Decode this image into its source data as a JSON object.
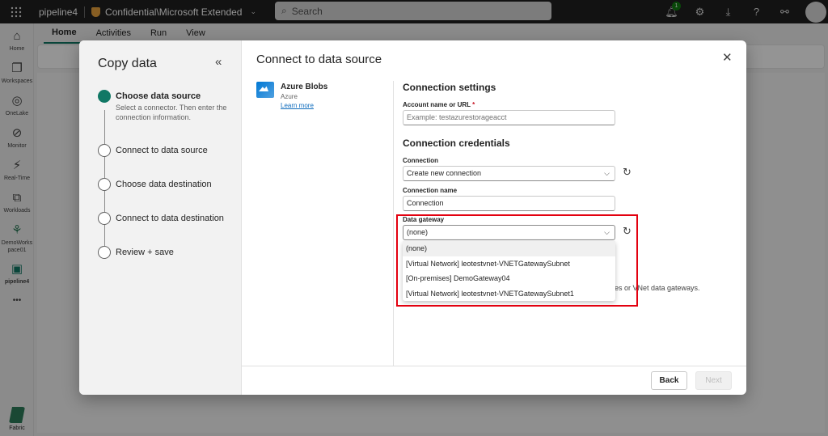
{
  "topbar": {
    "app_title": "pipeline4",
    "sensitivity_label": "Confidential\\Microsoft Extended",
    "search_placeholder": "Search",
    "notification_count": "1"
  },
  "rail": {
    "items": [
      {
        "label": "Home",
        "icon": "home-icon"
      },
      {
        "label": "Workspaces",
        "icon": "workspaces-icon"
      },
      {
        "label": "OneLake",
        "icon": "onelake-icon"
      },
      {
        "label": "Monitor",
        "icon": "monitor-icon"
      },
      {
        "label": "Real-Time",
        "icon": "realtime-icon"
      },
      {
        "label": "Workloads",
        "icon": "workloads-icon"
      },
      {
        "label": "DemoWorkspace01",
        "icon": "workspace-icon"
      },
      {
        "label": "pipeline4",
        "icon": "pipeline-icon"
      }
    ],
    "more": "•••",
    "footer_label": "Fabric"
  },
  "ribbon": {
    "tabs": [
      "Home",
      "Activities",
      "Run",
      "View"
    ]
  },
  "dialog": {
    "panel_title": "Copy data",
    "collapse_glyph": "«",
    "close_glyph": "✕",
    "main_title": "Connect to data source",
    "steps": [
      {
        "label": "Choose data source",
        "desc": "Select a connector. Then enter the connection information.",
        "active": true
      },
      {
        "label": "Connect to data source",
        "active": false
      },
      {
        "label": "Choose data destination",
        "active": false
      },
      {
        "label": "Connect to data destination",
        "active": false
      },
      {
        "label": "Review + save",
        "active": false
      }
    ],
    "connector": {
      "name": "Azure Blobs",
      "category": "Azure",
      "link": "Learn more"
    },
    "connection_settings": {
      "title": "Connection settings",
      "account_label": "Account name or URL",
      "required_mark": "*",
      "account_placeholder": "Example: testazurestorageacct"
    },
    "credentials": {
      "title": "Connection credentials",
      "connection_label": "Connection",
      "connection_value": "Create new connection",
      "connection_name_label": "Connection name",
      "connection_name_value": "Connection",
      "gateway_label": "Data gateway",
      "gateway_value": "(none)",
      "gateway_options": [
        "(none)",
        "[Virtual Network] leotestvnet-VNETGatewaySubnet",
        "[On-premises] DemoGateway04",
        "[Virtual Network] leotestvnet-VNETGatewaySubnet1"
      ],
      "hint_fragment": "es or VNet data gateways."
    },
    "buttons": {
      "back": "Back",
      "next": "Next"
    }
  },
  "colors": {
    "accent": "#117865",
    "highlight": "#e3000f",
    "link": "#0f6cbd"
  }
}
